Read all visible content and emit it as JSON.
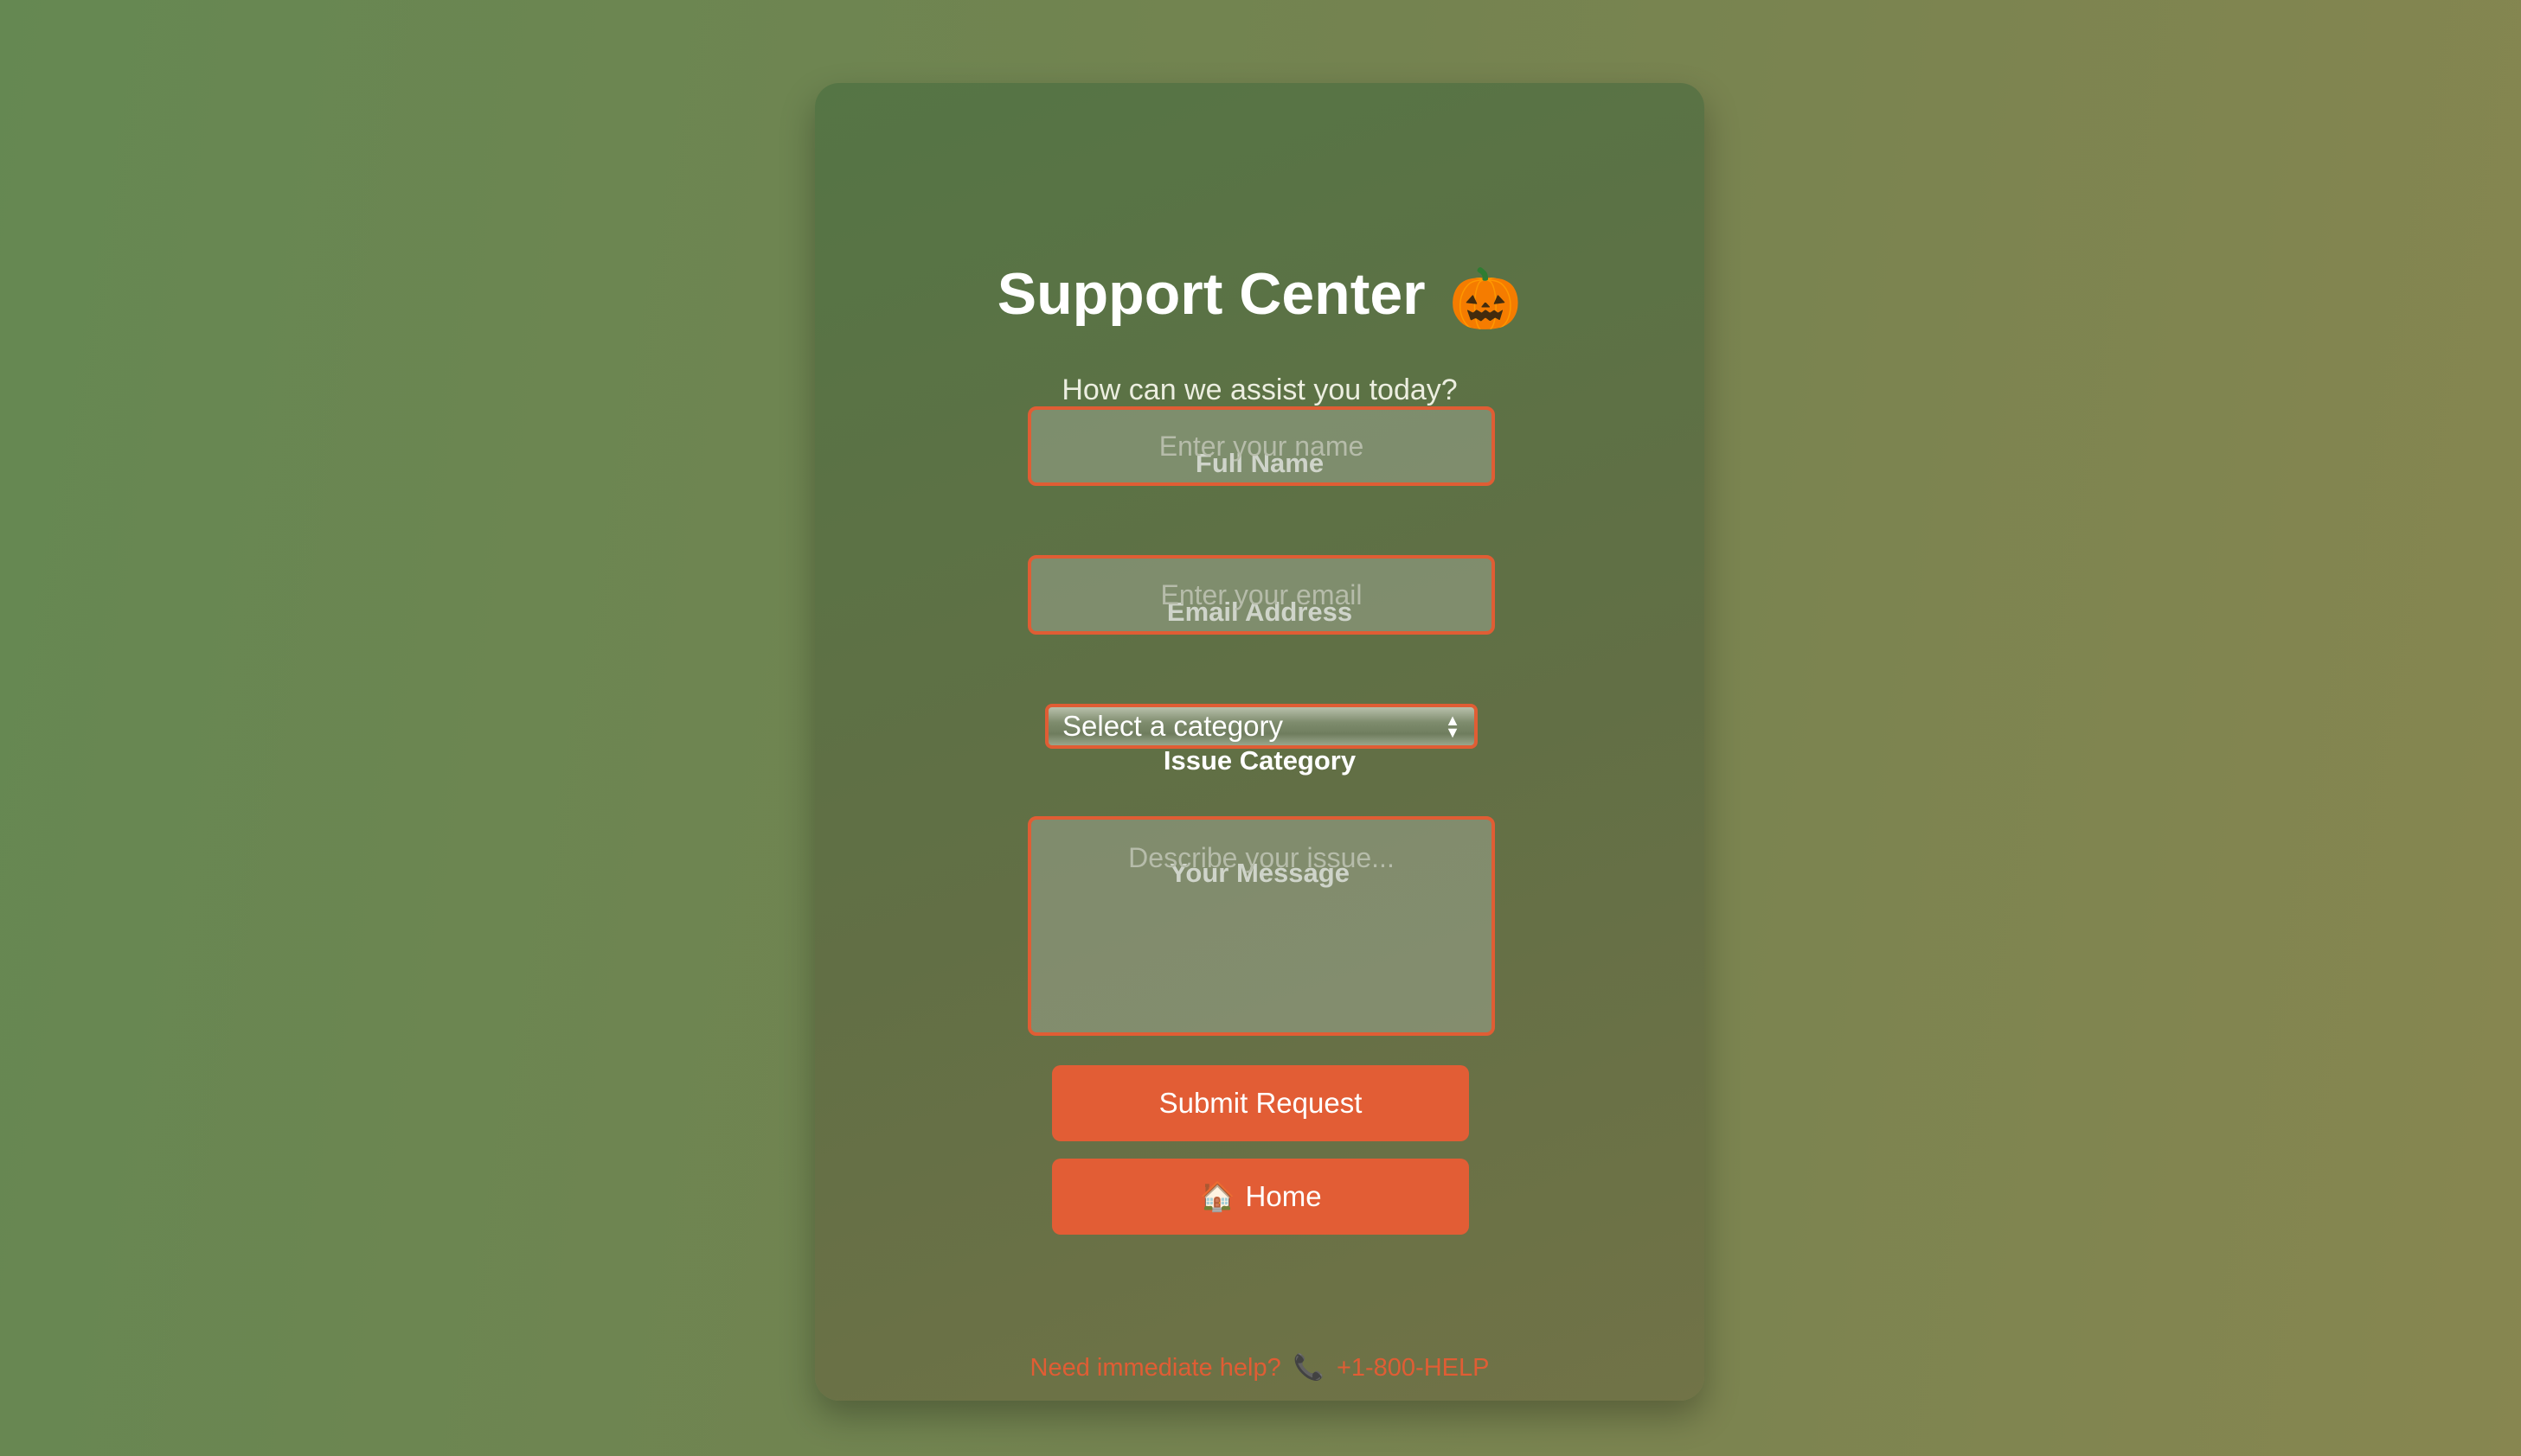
{
  "page": {
    "title": "Support Center",
    "title_icon": "pumpkin-icon",
    "title_emoji": "🎃",
    "subtitle": "How can we assist you today?"
  },
  "form": {
    "name": {
      "label": "Full Name",
      "placeholder": "Enter your name",
      "value": ""
    },
    "email": {
      "label": "Email Address",
      "placeholder": "Enter your email",
      "value": ""
    },
    "category": {
      "label": "Issue Category",
      "selected": "Select a category"
    },
    "message": {
      "label": "Your Message",
      "placeholder": "Describe your issue...",
      "value": ""
    },
    "submit_label": "Submit Request",
    "home_label": "Home",
    "home_icon": "house-icon",
    "home_emoji": "🏠"
  },
  "help": {
    "text": "Need immediate help?",
    "phone_icon": "phone-icon",
    "phone_emoji": "📞",
    "phone": "+1-800-HELP"
  },
  "colors": {
    "accent": "#e25d35",
    "background_start": "#658852",
    "background_end": "#878650",
    "card": "#5c7045"
  }
}
